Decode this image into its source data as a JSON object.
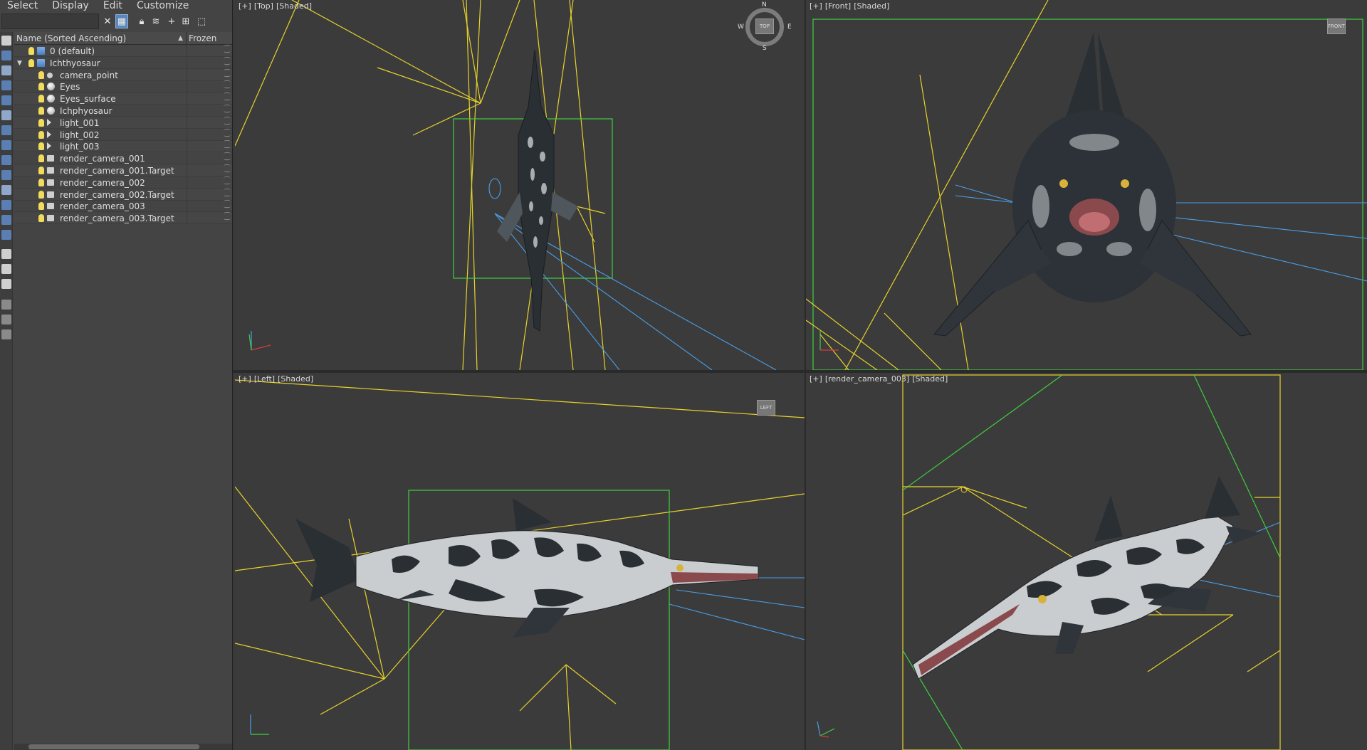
{
  "menu": [
    "Select",
    "Display",
    "Edit",
    "Customize"
  ],
  "search": {
    "placeholder": ""
  },
  "columns": {
    "name": "Name (Sorted Ascending)",
    "sort_indicator": "▲",
    "frozen": "Frozen"
  },
  "scene_items": [
    {
      "label": "0 (default)",
      "icon": "layer-icon",
      "depth": 0,
      "expander": ""
    },
    {
      "label": "Ichthyosaur",
      "icon": "layer-icon",
      "depth": 0,
      "expander": "▼"
    },
    {
      "label": "camera_point",
      "icon": "point-helper-icon",
      "depth": 1,
      "expander": ""
    },
    {
      "label": "Eyes",
      "icon": "sphere-object-icon",
      "depth": 1,
      "expander": ""
    },
    {
      "label": "Eyes_surface",
      "icon": "sphere-object-icon",
      "depth": 1,
      "expander": ""
    },
    {
      "label": "Ichphyosaur",
      "icon": "sphere-object-icon",
      "depth": 1,
      "expander": ""
    },
    {
      "label": "light_001",
      "icon": "light-icon",
      "depth": 1,
      "expander": ""
    },
    {
      "label": "light_002",
      "icon": "light-icon",
      "depth": 1,
      "expander": ""
    },
    {
      "label": "light_003",
      "icon": "light-icon",
      "depth": 1,
      "expander": ""
    },
    {
      "label": "render_camera_001",
      "icon": "camera-icon",
      "depth": 1,
      "expander": ""
    },
    {
      "label": "render_camera_001.Target",
      "icon": "camera-icon",
      "depth": 1,
      "expander": ""
    },
    {
      "label": "render_camera_002",
      "icon": "camera-icon",
      "depth": 1,
      "expander": ""
    },
    {
      "label": "render_camera_002.Target",
      "icon": "camera-icon",
      "depth": 1,
      "expander": ""
    },
    {
      "label": "render_camera_003",
      "icon": "camera-icon",
      "depth": 1,
      "expander": ""
    },
    {
      "label": "render_camera_003.Target",
      "icon": "camera-icon",
      "depth": 1,
      "expander": ""
    }
  ],
  "viewports": {
    "top": {
      "plus": "[+]",
      "view": "[Top]",
      "shading": "[Shaded]",
      "cube": "TOP",
      "compass": [
        "N",
        "E",
        "S",
        "W"
      ]
    },
    "front": {
      "plus": "[+]",
      "view": "[Front]",
      "shading": "[Shaded]",
      "cube": "FRONT"
    },
    "left": {
      "plus": "[+]",
      "view": "[Left]",
      "shading": "[Shaded]",
      "cube": "LEFT"
    },
    "camera": {
      "plus": "[+]",
      "view": "[render_camera_003]",
      "shading": "[Shaded]"
    }
  },
  "colors": {
    "light_lines": "#e8d22b",
    "selection_box": "#3fcf3f",
    "camera_lines": "#4a9ee8",
    "viewport_bg": "#3b3b3b",
    "creature_dark": "#2a2f34",
    "creature_light": "#c9cdd0"
  }
}
